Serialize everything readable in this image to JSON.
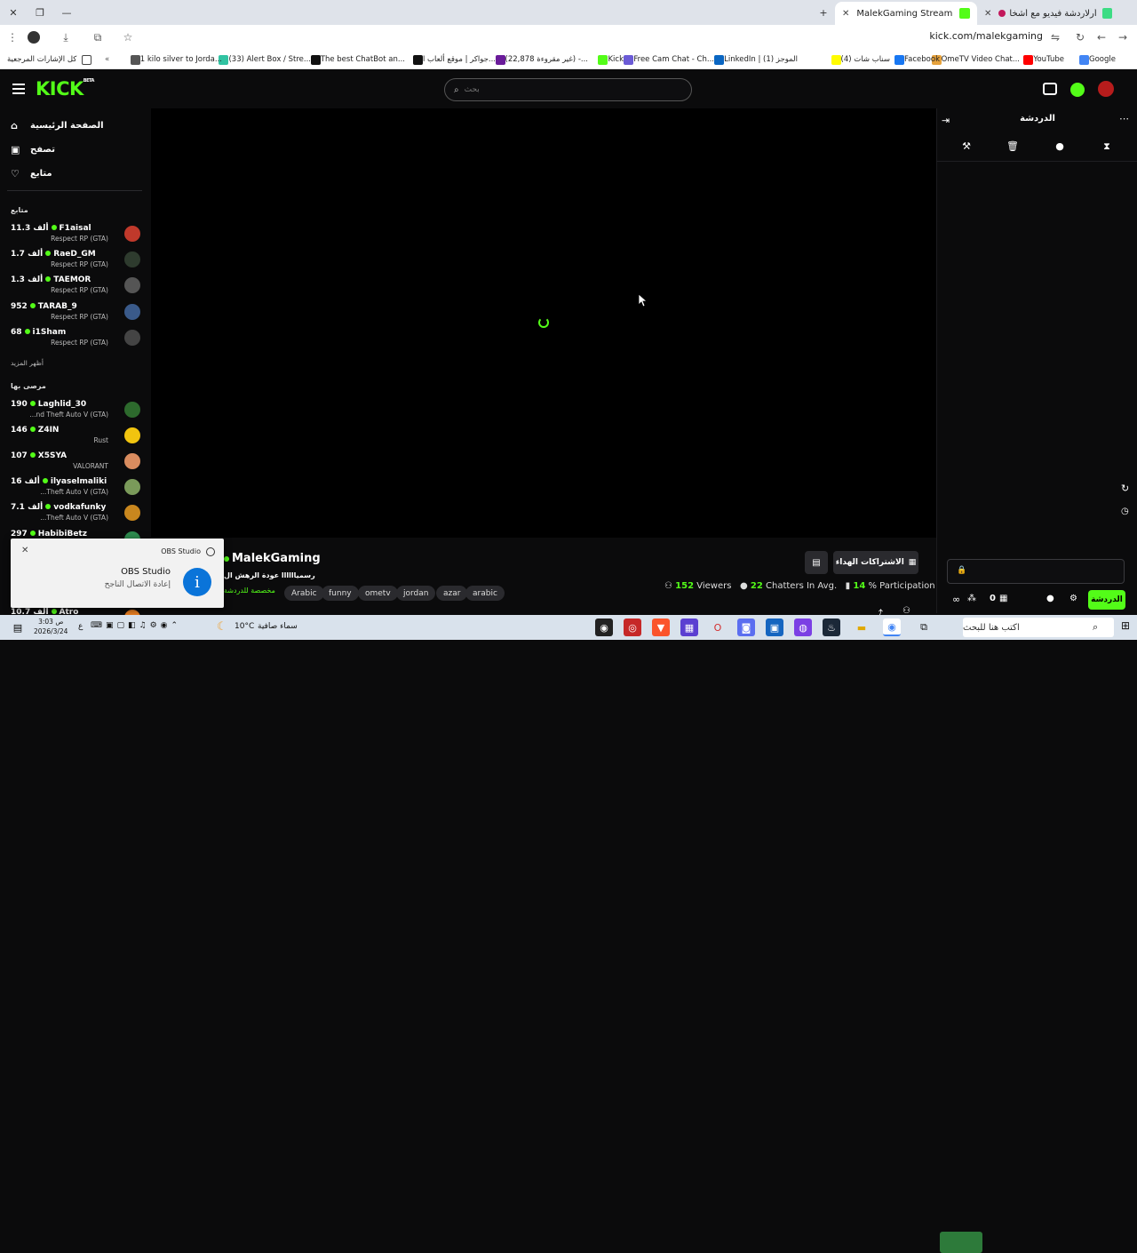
{
  "browser": {
    "tabs": [
      {
        "title": "MalekGaming Stream - Watch",
        "active": true,
        "favicon_color": "#53fc18"
      },
      {
        "title": "أرلاردشة فيديو مع أشخاص",
        "active": false,
        "favicon_color": "#3ddc84"
      }
    ],
    "url": "kick.com/malekgaming",
    "bookmarks": [
      {
        "label": "Google",
        "color": "#4285f4"
      },
      {
        "label": "YouTube",
        "color": "#ff0000"
      },
      {
        "label": "OmeTV Video Chat...",
        "color": "#e6a23c"
      },
      {
        "label": "Facebook",
        "color": "#1877f2"
      },
      {
        "label": "(4) سناب شات",
        "color": "#fffc00"
      },
      {
        "label": "LinkedIn | (1) الموجز",
        "color": "#0a66c2"
      },
      {
        "label": "Free Cam Chat - Ch...",
        "color": "#6b5bd6"
      },
      {
        "label": "Kick",
        "color": "#53fc18"
      },
      {
        "label": "(22,878 غير مقروءة) -...",
        "color": "#6a1b9a"
      },
      {
        "label": "جواكر | موقع ألعاب ا...",
        "color": "#111111"
      },
      {
        "label": "The best ChatBot an...",
        "color": "#111111"
      },
      {
        "label": "(33) Alert Box / Stre...",
        "color": "#31c3a2"
      },
      {
        "label": "1 kilo silver to Jorda...",
        "color": "#555555"
      },
      {
        "label": "كل الإشارات المرجعية",
        "color": "#444444"
      }
    ]
  },
  "kick": {
    "search_placeholder": "بحث",
    "nav": [
      {
        "label": "الصفحة الرئيسية",
        "icon": "home-icon"
      },
      {
        "label": "تصفح",
        "icon": "browse-icon"
      },
      {
        "label": "متابع",
        "icon": "heart-icon"
      }
    ],
    "following_heading": "متابع",
    "following": [
      {
        "name": "F1aisal",
        "viewers": "11.3 ألف",
        "category": "Respect RP (GTA)",
        "avatar_color": "#c0392b"
      },
      {
        "name": "RaeD_GM",
        "viewers": "1.7 ألف",
        "category": "Respect RP (GTA)",
        "avatar_color": "#2e3b2e"
      },
      {
        "name": "TAEMOR",
        "viewers": "1.3 ألف",
        "category": "Respect RP (GTA)",
        "avatar_color": "#555555"
      },
      {
        "name": "TARAB_9",
        "viewers": "952",
        "category": "Respect RP (GTA)",
        "avatar_color": "#3a5a8a"
      },
      {
        "name": "i1Sham",
        "viewers": "68",
        "category": "Respect RP (GTA)",
        "avatar_color": "#444444"
      }
    ],
    "show_more": "أظهر المزيد",
    "recommended_heading": "مرصى بها",
    "recommended": [
      {
        "name": "Laghlid_30",
        "viewers": "190",
        "category": "...nd Theft Auto V (GTA)",
        "avatar_color": "#2d6a2d"
      },
      {
        "name": "Z4IN",
        "viewers": "146",
        "category": "Rust",
        "avatar_color": "#f1c40f"
      },
      {
        "name": "X5SYA",
        "viewers": "107",
        "category": "VALORANT",
        "avatar_color": "#d98c5f"
      },
      {
        "name": "ilyaselmaliki",
        "viewers": "16 ألف",
        "category": "...Theft Auto V (GTA)",
        "avatar_color": "#7a9a5a"
      },
      {
        "name": "vodkafunky",
        "viewers": "7.1 ألف",
        "category": "...Theft Auto V (GTA)",
        "avatar_color": "#c9871e"
      },
      {
        "name": "HabibiBetz",
        "viewers": "297",
        "category": "",
        "avatar_color": "#2d8a4e"
      },
      {
        "name": "Atro",
        "viewers": "10.7 ألف",
        "category": "",
        "avatar_color": "#e67e22"
      }
    ],
    "chat": {
      "title": "الدردشة",
      "send_label": "الدردشة",
      "count": "0"
    },
    "stream": {
      "streamer": "MalekGaming",
      "title_line": "رسمياااااا عودة الرهش ال",
      "category_line": "مخصصة للدردشة",
      "tags": [
        "Arabic",
        "funny",
        "ometv",
        "jordan",
        "azar",
        "arabic"
      ],
      "subscribe_label": "الاشتراكات الهداء",
      "viewers": "152",
      "viewers_label": "Viewers",
      "chatters": "22",
      "chatters_label": "Chatters In Avg.",
      "participation": "14",
      "participation_label": "% Participation"
    }
  },
  "notification": {
    "app": "OBS Studio",
    "title": "OBS Studio",
    "body": "إعادة الاتصال الناجح"
  },
  "taskbar": {
    "search_placeholder": "اكتب هنا للبحث",
    "weather": "سماء صافية",
    "temp": "10°C",
    "time": "3:03 ص",
    "date": "2026/3/24",
    "lang": "ع"
  },
  "colors": {
    "accent": "#53fc18",
    "bg": "#0b0b0c"
  }
}
